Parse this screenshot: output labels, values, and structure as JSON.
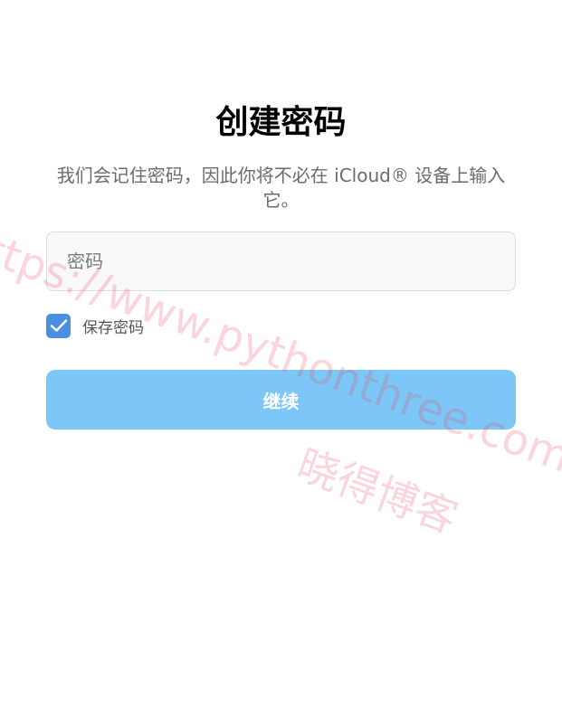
{
  "screen": {
    "title": "创建密码",
    "subtitle": "我们会记住密码，因此你将不必在 iCloud® 设备上输入它。"
  },
  "password_field": {
    "placeholder": "密码",
    "value": ""
  },
  "save_password": {
    "label": "保存密码",
    "checked": true
  },
  "continue_button": {
    "label": "继续"
  },
  "watermark": {
    "url_text": "ttps://www.pythonthree.com",
    "brand_text": "晓得博客"
  },
  "colors": {
    "accent": "#4a90e2",
    "button": "#7cc7f7",
    "watermark": "#e8465f"
  }
}
